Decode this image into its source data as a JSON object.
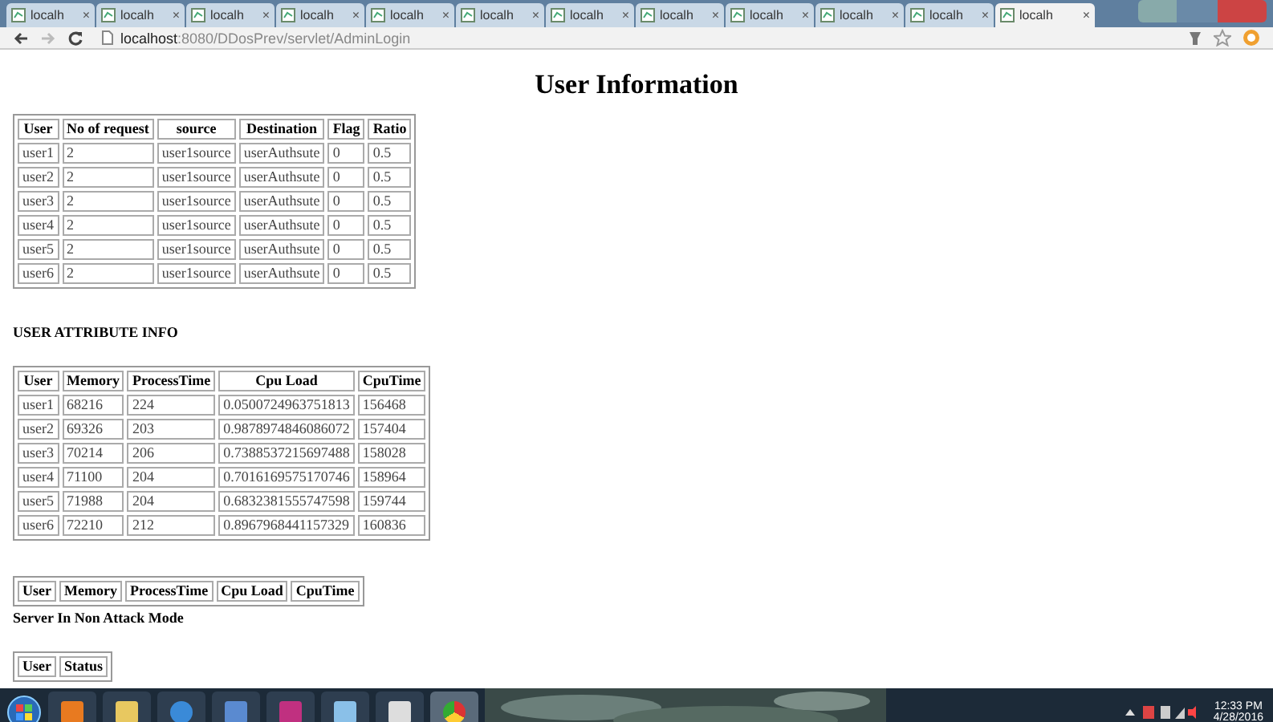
{
  "browser": {
    "tabs": [
      {
        "label": "localh",
        "selected": false
      },
      {
        "label": "localh",
        "selected": false
      },
      {
        "label": "localh",
        "selected": false
      },
      {
        "label": "localh",
        "selected": false
      },
      {
        "label": "localh",
        "selected": false
      },
      {
        "label": "localh",
        "selected": false
      },
      {
        "label": "localh",
        "selected": false
      },
      {
        "label": "localh",
        "selected": false
      },
      {
        "label": "localh",
        "selected": false
      },
      {
        "label": "localh",
        "selected": false
      },
      {
        "label": "localh",
        "selected": false
      },
      {
        "label": "localh",
        "selected": true
      }
    ],
    "close_glyph": "×",
    "url_host": "localhost",
    "url_rest": ":8080/DDosPrev/servlet/AdminLogin"
  },
  "page": {
    "title": "User Information",
    "sections": [
      {
        "table": {
          "columns": [
            "User",
            "No of request",
            "source",
            "Destination",
            "Flag",
            "Ratio"
          ],
          "rows": [
            [
              "user1",
              "2",
              "user1source",
              "userAuthsute",
              "0",
              "0.5"
            ],
            [
              "user2",
              "2",
              "user1source",
              "userAuthsute",
              "0",
              "0.5"
            ],
            [
              "user3",
              "2",
              "user1source",
              "userAuthsute",
              "0",
              "0.5"
            ],
            [
              "user4",
              "2",
              "user1source",
              "userAuthsute",
              "0",
              "0.5"
            ],
            [
              "user5",
              "2",
              "user1source",
              "userAuthsute",
              "0",
              "0.5"
            ],
            [
              "user6",
              "2",
              "user1source",
              "userAuthsute",
              "0",
              "0.5"
            ]
          ]
        }
      },
      {
        "heading": "USER ATTRIBUTE INFO",
        "table": {
          "columns": [
            "User",
            "Memory",
            "ProcessTime",
            "Cpu Load",
            "CpuTime"
          ],
          "rows": [
            [
              "user1",
              "68216",
              "224",
              "0.0500724963751813",
              "156468"
            ],
            [
              "user2",
              "69326",
              "203",
              "0.9878974846086072",
              "157404"
            ],
            [
              "user3",
              "70214",
              "206",
              "0.7388537215697488",
              "158028"
            ],
            [
              "user4",
              "71100",
              "204",
              "0.7016169575170746",
              "158964"
            ],
            [
              "user5",
              "71988",
              "204",
              "0.6832381555747598",
              "159744"
            ],
            [
              "user6",
              "72210",
              "212",
              "0.8967968441157329",
              "160836"
            ]
          ]
        }
      },
      {
        "table": {
          "columns": [
            "User",
            "Memory",
            "ProcessTime",
            "Cpu Load",
            "CpuTime"
          ]
        },
        "note": "Server In Non Attack Mode"
      },
      {
        "table": {
          "columns": [
            "User",
            "Status"
          ]
        }
      }
    ]
  },
  "taskbar": {
    "time": "12:33 PM",
    "date": "4/28/2016"
  }
}
